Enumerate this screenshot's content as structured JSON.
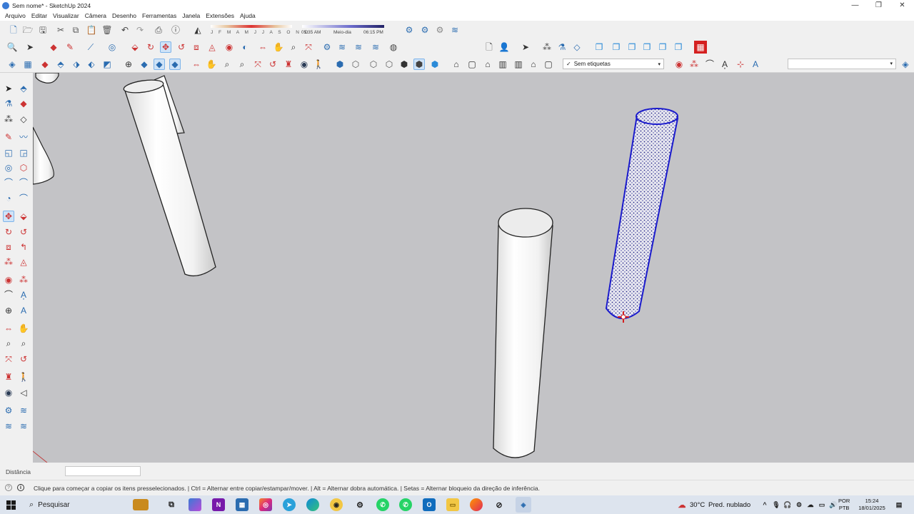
{
  "window": {
    "title": "Sem nome* - SketchUp 2024",
    "controls": [
      "—",
      "❐",
      "✕"
    ]
  },
  "menu": [
    "Arquivo",
    "Editar",
    "Visualizar",
    "Câmera",
    "Desenho",
    "Ferramentas",
    "Janela",
    "Extensões",
    "Ajuda"
  ],
  "shadow": {
    "months": "J F M A M J J A S O N D",
    "sunrise": "05:35 AM",
    "noon": "Meio-dia",
    "sunset": "06:15 PM"
  },
  "tags": {
    "selected": "Sem etiquetas",
    "check": "✓"
  },
  "active_tool": "move",
  "vcb": {
    "label": "Distância",
    "value": ""
  },
  "status": {
    "message": "Clique para começar a copiar os itens presselecionados. | Ctrl = Alternar entre copiar/estampar/mover. | Alt = Alternar dobra automática. | Setas = Alternar bloqueio da direção de inferência."
  },
  "taskbar": {
    "search_placeholder": "Pesquisar",
    "weather_temp": "30°C",
    "weather_desc": "Pred. nublado",
    "lang_line1": "POR",
    "lang_line2": "PTB",
    "time": "15:24",
    "date": "18/01/2025"
  },
  "colors": {
    "viewport_bg": "#c3c3c6",
    "selection": "#1a1acc",
    "accent_red": "#d42020"
  },
  "icons": {
    "toolbar_main": [
      "new-file-icon",
      "open-icon",
      "save-icon",
      "cut-icon",
      "copy-icon",
      "paste-icon",
      "erase-icon",
      "undo-icon",
      "redo-icon",
      "print-icon",
      "model-info-icon",
      "shadows-icon"
    ],
    "toolbar_tools": [
      "zoom-icon",
      "select-icon",
      "eraser-icon",
      "pencil-icon",
      "line-icon",
      "circle-icon",
      "pushpull-icon",
      "followme-icon",
      "move-icon",
      "rotate-icon",
      "scale-icon",
      "offset-icon",
      "tape-icon",
      "dimension-icon",
      "text-icon",
      "axes-icon",
      "protractor-icon",
      "paint-icon"
    ],
    "left_tools": [
      "select-icon",
      "component-icon",
      "paint-bucket-icon",
      "eraser-icon",
      "tag-icon",
      "eraser-alt-icon",
      "line-icon",
      "freehand-icon",
      "rectangle-icon",
      "rotated-rect-icon",
      "circle-icon",
      "polygon-icon",
      "arc-icon",
      "arc-2pt-icon",
      "pie-icon",
      "arc-3pt-icon",
      "move-icon",
      "pushpull-icon",
      "rotate-icon",
      "followme-icon",
      "scale-icon",
      "offset-icon",
      "tape-icon",
      "dimension-icon",
      "protractor-icon",
      "text-icon",
      "axes-icon",
      "3dtext-icon",
      "orbit-icon",
      "pan-icon",
      "zoom-icon",
      "zoom-window-icon",
      "zoom-extents-icon",
      "previous-view-icon",
      "position-camera-icon",
      "walk-icon",
      "look-around-icon",
      "section-plane-icon",
      "sandbox-icon",
      "warehouse-icon",
      "extension-icon",
      "layout-icon"
    ]
  }
}
